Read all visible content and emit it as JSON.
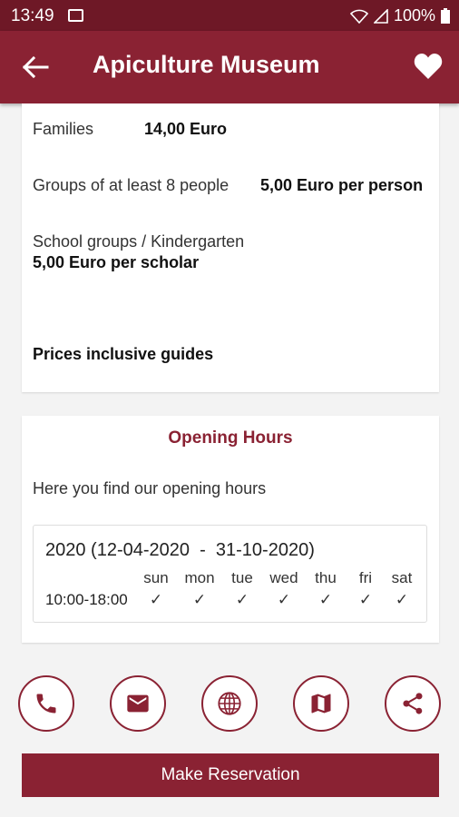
{
  "status_bar": {
    "time": "13:49",
    "battery": "100%"
  },
  "app_bar": {
    "title": "Apiculture Museum"
  },
  "prices": {
    "families_label": "Families",
    "families_value": "14,00 Euro",
    "groups_label": "Groups of at least 8 people",
    "groups_value": "5,00 Euro per person",
    "school_label": "School groups / Kindergarten",
    "school_value": "5,00 Euro per scholar",
    "note": "Prices inclusive guides"
  },
  "opening_hours": {
    "title": "Opening Hours",
    "intro": "Here you find our opening hours",
    "period": "2020 (12-04-2020  -  31-10-2020)",
    "time": "10:00-18:00",
    "days": [
      "sun",
      "mon",
      "tue",
      "wed",
      "thu",
      "fri",
      "sat"
    ],
    "check": "✓"
  },
  "actions": [
    "phone-icon",
    "email-icon",
    "globe-icon",
    "map-icon",
    "share-icon"
  ],
  "reserve_label": "Make Reservation",
  "colors": {
    "primary": "#8a2233",
    "status_bar": "#6e1826"
  }
}
